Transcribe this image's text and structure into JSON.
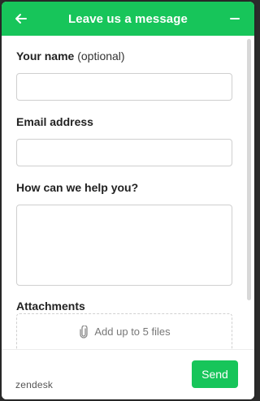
{
  "header": {
    "title": "Leave us a message",
    "back_icon": "arrow-left-icon",
    "minimize_icon": "minus-icon",
    "color": "#17c55a"
  },
  "form": {
    "name": {
      "label": "Your name",
      "optional": "(optional)",
      "value": ""
    },
    "email": {
      "label": "Email address",
      "value": ""
    },
    "message": {
      "label": "How can we help you?",
      "value": ""
    },
    "attachments": {
      "label": "Attachments",
      "dropzone_text": "Add up to 5 files",
      "icon": "paperclip-icon"
    }
  },
  "footer": {
    "brand": "zendesk",
    "send_label": "Send"
  }
}
